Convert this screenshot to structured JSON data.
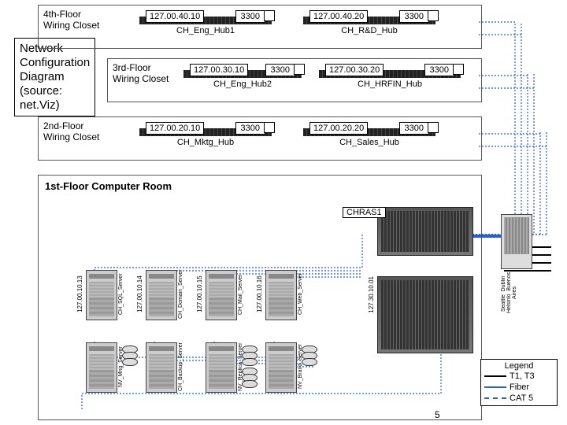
{
  "title": {
    "l1": "Network",
    "l2": "Configuration",
    "l3": "Diagram",
    "l4": "(source:",
    "l5": "net.Viz)"
  },
  "floors": {
    "f4": {
      "label_l1": "4th-Floor",
      "label_l2": "Wiring Closet",
      "hubA": {
        "ip": "127.00.40.10",
        "port": "3300",
        "name": "CH_Eng_Hub1"
      },
      "hubB": {
        "ip": "127.00.40.20",
        "port": "3300",
        "name": "CH_R&D_Hub"
      }
    },
    "f3": {
      "label_l1": "3rd-Floor",
      "label_l2": "Wiring Closet",
      "hubA": {
        "ip": "127.00.30.10",
        "port": "3300",
        "name": "CH_Eng_Hub2"
      },
      "hubB": {
        "ip": "127.00.30.20",
        "port": "3300",
        "name": "CH_HRFIN_Hub"
      }
    },
    "f2": {
      "label_l1": "2nd-Floor",
      "label_l2": "Wiring Closet",
      "hubA": {
        "ip": "127.00.20.10",
        "port": "3300",
        "name": "CH_Mktg_Hub"
      },
      "hubB": {
        "ip": "127.00.20.20",
        "port": "3300",
        "name": "CH_Sales_Hub"
      }
    }
  },
  "room": {
    "label": "1st-Floor Computer Room",
    "rack1": "CHRAS1",
    "router_ip": "127.30.10.01",
    "wan": {
      "l1": "Seattle",
      "l2": "Dublin",
      "l3": "Helsinki",
      "l4": "Buenos Aires"
    },
    "serversTop": [
      {
        "ip": "127.00.10.13",
        "name": "CH_SQL_Server"
      },
      {
        "ip": "127.00.10.14",
        "name": "CH_Domain_Server"
      },
      {
        "ip": "127.00.10.15",
        "name": "CH_Mail_Server"
      },
      {
        "ip": "127.00.10.16",
        "name": "CH_Web_Server"
      }
    ],
    "serversBottom": [
      {
        "ip": "",
        "name": "NV_Mng_Server"
      },
      {
        "ip": "",
        "name": "CH_Backup_Server"
      },
      {
        "ip": "",
        "name": "NV_Replica_Server"
      },
      {
        "ip": "",
        "name": "NV_Brand_Server"
      }
    ]
  },
  "legend": {
    "title": "Legend",
    "t1": "T1, T3",
    "fiber": "Fiber",
    "cat5": "CAT 5"
  },
  "page": "5"
}
